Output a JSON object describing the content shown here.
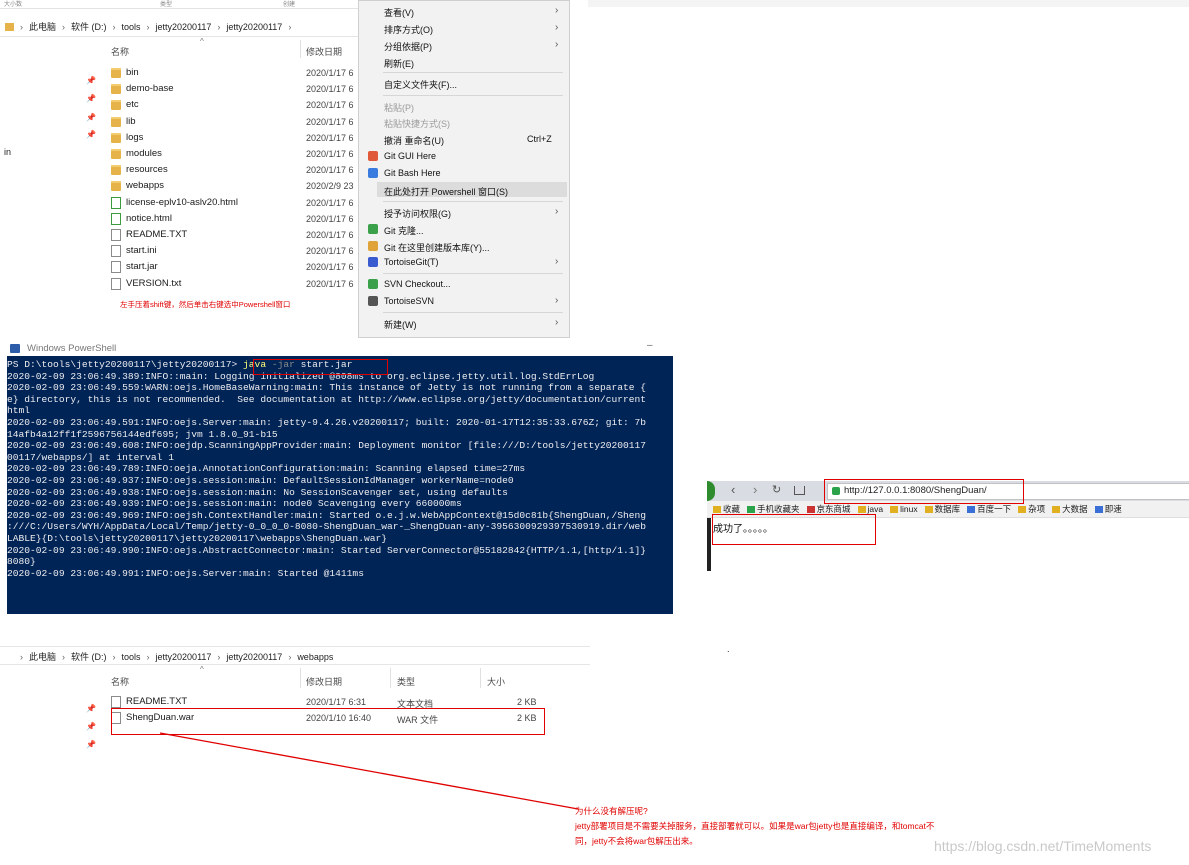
{
  "explorer_top": {
    "top_strip": [
      "大小数",
      "类型",
      "创建"
    ],
    "breadcrumb": [
      "此电脑",
      "软件 (D:)",
      "tools",
      "jetty20200117",
      "jetty20200117"
    ],
    "col_name": "名称",
    "col_date": "修改日期",
    "left_stub": "in",
    "files": [
      {
        "name": "bin",
        "date": "2020/1/17 6",
        "icon": "folder-icon"
      },
      {
        "name": "demo-base",
        "date": "2020/1/17 6",
        "icon": "folder-icon"
      },
      {
        "name": "etc",
        "date": "2020/1/17 6",
        "icon": "folder-icon"
      },
      {
        "name": "lib",
        "date": "2020/1/17 6",
        "icon": "folder-icon"
      },
      {
        "name": "logs",
        "date": "2020/1/17 6",
        "icon": "folder-icon"
      },
      {
        "name": "modules",
        "date": "2020/1/17 6",
        "icon": "folder-icon"
      },
      {
        "name": "resources",
        "date": "2020/1/17 6",
        "icon": "folder-icon"
      },
      {
        "name": "webapps",
        "date": "2020/2/9 23",
        "icon": "folder-icon"
      },
      {
        "name": "license-eplv10-aslv20.html",
        "date": "2020/1/17 6",
        "icon": "html-file-icon"
      },
      {
        "name": "notice.html",
        "date": "2020/1/17 6",
        "icon": "html-file-icon"
      },
      {
        "name": "README.TXT",
        "date": "2020/1/17 6",
        "icon": "text-file-icon"
      },
      {
        "name": "start.ini",
        "date": "2020/1/17 6",
        "icon": "ini-file-icon"
      },
      {
        "name": "start.jar",
        "date": "2020/1/17 6",
        "icon": "jar-file-icon"
      },
      {
        "name": "VERSION.txt",
        "date": "2020/1/17 6",
        "icon": "text-file-icon"
      }
    ],
    "annotation": "左手压着shift键，然后单击右键选中Powershell窗口"
  },
  "context_menu": {
    "items": [
      {
        "label": "查看(V)",
        "submenu": true,
        "disabled": false
      },
      {
        "label": "排序方式(O)",
        "submenu": true,
        "disabled": false
      },
      {
        "label": "分组依据(P)",
        "submenu": true,
        "disabled": false
      },
      {
        "label": "刷新(E)",
        "submenu": false,
        "disabled": false
      },
      {
        "label": "自定义文件夹(F)...",
        "submenu": false,
        "disabled": false
      },
      {
        "label": "粘贴(P)",
        "submenu": false,
        "disabled": true
      },
      {
        "label": "粘贴快捷方式(S)",
        "submenu": false,
        "disabled": true
      },
      {
        "label": "撤消 重命名(U)",
        "shortcut": "Ctrl+Z",
        "submenu": false,
        "disabled": false
      },
      {
        "label": "Git GUI Here",
        "submenu": false,
        "disabled": false,
        "icon": "git-gui-icon"
      },
      {
        "label": "Git Bash Here",
        "submenu": false,
        "disabled": false,
        "icon": "git-bash-icon"
      },
      {
        "label": "在此处打开 Powershell 窗口(S)",
        "submenu": false,
        "disabled": false,
        "highlighted": true
      },
      {
        "label": "授予访问权限(G)",
        "submenu": true,
        "disabled": false
      },
      {
        "label": "Git 克隆...",
        "submenu": false,
        "disabled": false,
        "icon": "git-clone-icon"
      },
      {
        "label": "Git 在这里创建版本库(Y)...",
        "submenu": false,
        "disabled": false,
        "icon": "git-repo-icon"
      },
      {
        "label": "TortoiseGit(T)",
        "submenu": true,
        "disabled": false,
        "icon": "tortoisegit-icon"
      },
      {
        "label": "SVN Checkout...",
        "submenu": false,
        "disabled": false,
        "icon": "svn-checkout-icon"
      },
      {
        "label": "TortoiseSVN",
        "submenu": true,
        "disabled": false,
        "icon": "tortoisesvn-icon"
      },
      {
        "label": "新建(W)",
        "submenu": true,
        "disabled": false
      }
    ]
  },
  "powershell": {
    "title": "Windows PowerShell",
    "prompt": "PS D:\\tools\\jetty20200117\\jetty20200117> ",
    "command": "java -jar start.jar",
    "lines": [
      "2020-02-09 23:06:49.389:INFO::main: Logging initialized @808ms to org.eclipse.jetty.util.log.StdErrLog",
      "2020-02-09 23:06:49.559:WARN:oejs.HomeBaseWarning:main: This instance of Jetty is not running from a separate {",
      "e} directory, this is not recommended.  See documentation at http://www.eclipse.org/jetty/documentation/current",
      "html",
      "2020-02-09 23:06:49.591:INFO:oejs.Server:main: jetty-9.4.26.v20200117; built: 2020-01-17T12:35:33.676Z; git: 7b",
      "14afb4a12ff1f2596756144edf695; jvm 1.8.0_91-b15",
      "2020-02-09 23:06:49.608:INFO:oejdp.ScanningAppProvider:main: Deployment monitor [file:///D:/tools/jetty20200117",
      "00117/webapps/] at interval 1",
      "2020-02-09 23:06:49.789:INFO:oeja.AnnotationConfiguration:main: Scanning elapsed time=27ms",
      "2020-02-09 23:06:49.937:INFO:oejs.session:main: DefaultSessionIdManager workerName=node0",
      "2020-02-09 23:06:49.938:INFO:oejs.session:main: No SessionScavenger set, using defaults",
      "2020-02-09 23:06:49.939:INFO:oejs.session:main: node0 Scavenging every 660000ms",
      "2020-02-09 23:06:49.969:INFO:oejsh.ContextHandler:main: Started o.e.j.w.WebAppContext@15d0c81b{ShengDuan,/Sheng",
      ":///C:/Users/WYH/AppData/Local/Temp/jetty-0_0_0_0-8080-ShengDuan_war-_ShengDuan-any-3956300929397530919.dir/web",
      "LABLE}{D:\\tools\\jetty20200117\\jetty20200117\\webapps\\ShengDuan.war}",
      "2020-02-09 23:06:49.990:INFO:oejs.AbstractConnector:main: Started ServerConnector@55182842{HTTP/1.1,[http/1.1]}",
      "8080}",
      "2020-02-09 23:06:49.991:INFO:oejs.Server:main: Started @1411ms"
    ]
  },
  "browser": {
    "url": "http://127.0.0.1:8080/ShengDuan/",
    "bookmarks": [
      "收藏",
      "手机收藏夹",
      "京东商城",
      "java",
      "linux",
      "数据库",
      "百度一下",
      "杂项",
      "大数据",
      "即速"
    ],
    "page_text": "成功了。。。。。",
    "dot": "."
  },
  "explorer_bottom": {
    "breadcrumb": [
      "此电脑",
      "软件 (D:)",
      "tools",
      "jetty20200117",
      "jetty20200117",
      "webapps"
    ],
    "columns": [
      "名称",
      "修改日期",
      "类型",
      "大小"
    ],
    "files": [
      {
        "name": "README.TXT",
        "date": "2020/1/17 6:31",
        "type": "文本文档",
        "size": "2 KB",
        "icon": "text-file-icon"
      },
      {
        "name": "ShengDuan.war",
        "date": "2020/1/10 16:40",
        "type": "WAR 文件",
        "size": "2 KB",
        "icon": "war-file-icon"
      }
    ]
  },
  "annotation_bottom": {
    "line1": "为什么没有解压呢?",
    "line2": "jetty部署项目是不需要关掉服务，直接部署就可以。如果是war包jetty也是直接编译，和tomcat不",
    "line3": "同，jetty不会将war包解压出来。"
  },
  "watermark": "https://blog.csdn.net/TimeMoments",
  "colors": {
    "annotation_red": "#e00000",
    "powershell_bg": "#012456",
    "menu_bg": "#f2f2f2"
  }
}
